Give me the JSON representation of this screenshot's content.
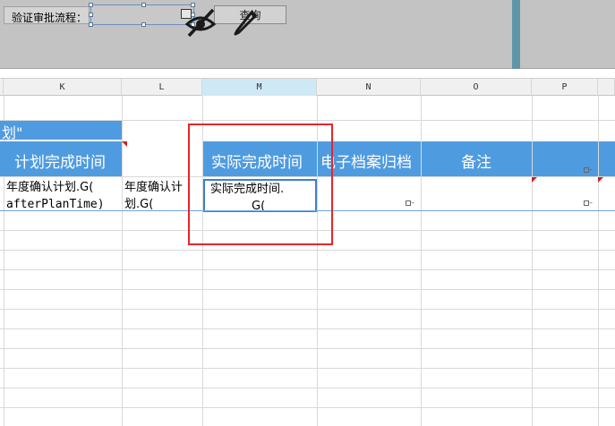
{
  "param_panel": {
    "label": "验证审批流程：",
    "query_button": "查询",
    "icons": [
      "eye-slash-icon",
      "pen-icon"
    ]
  },
  "columns": [
    "K",
    "L",
    "M",
    "N",
    "O",
    "P"
  ],
  "active_column": "M",
  "title_fragment": "划\"",
  "headers": {
    "planned_finish": "计划完成时间",
    "actual_finish": "实际完成时间",
    "e_archive": "电子档案归档",
    "remarks": "备注"
  },
  "row1": {
    "k_line1": "年度确认计划.G(",
    "k_line2": "afterPlanTime)",
    "l_line1": "年度确认计",
    "l_line2": "划.G(",
    "m_line1": "实际完成时间.",
    "m_line2": "G("
  },
  "colors": {
    "header_blue": "#4f9be0",
    "highlight_red": "#e6262a",
    "selection_blue": "#3c7fd4",
    "param_panel_gray": "#c3c3c3"
  }
}
